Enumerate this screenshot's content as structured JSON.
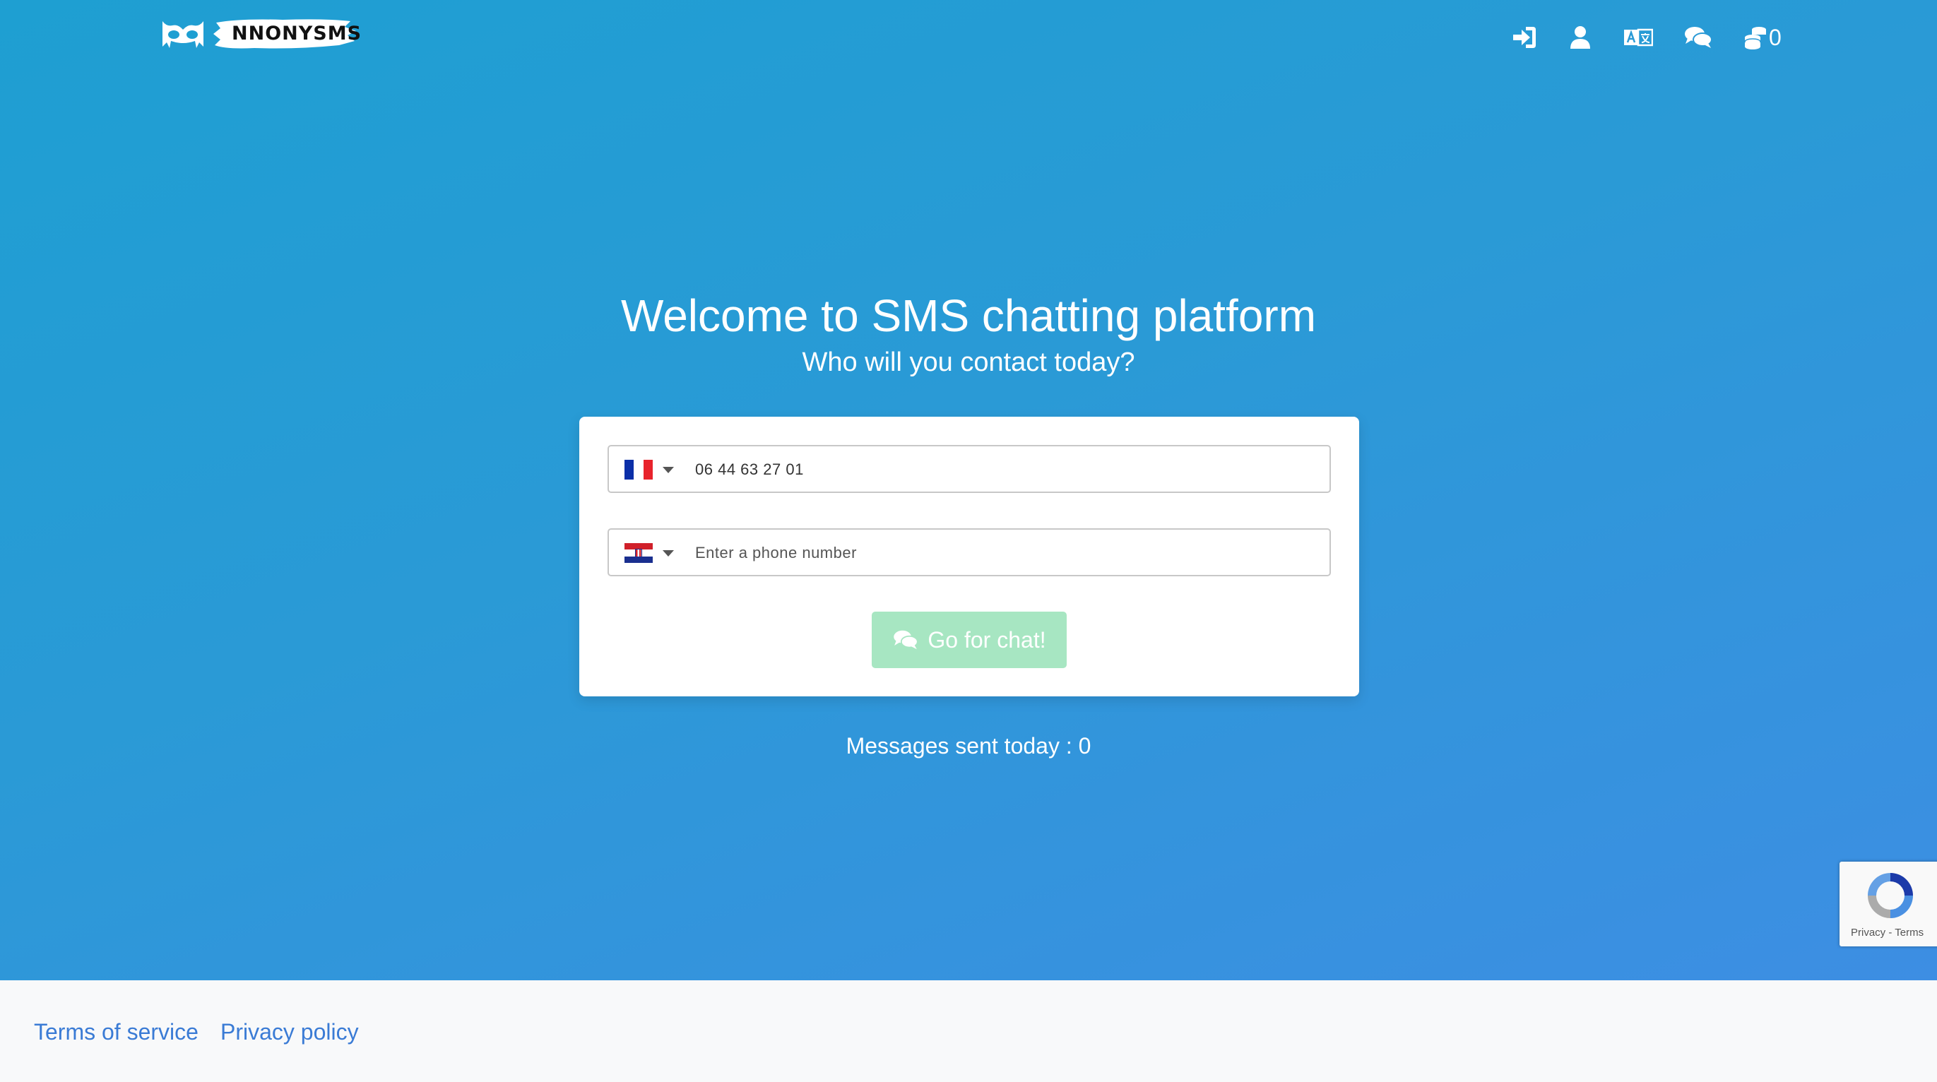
{
  "brand": {
    "name": "ΝNONYSMS"
  },
  "nav": {
    "login_icon": "sign-in-icon",
    "account_icon": "user-icon",
    "language_icon": "translate-icon",
    "chats_icon": "comments-icon",
    "coins_icon": "coins-icon",
    "coin_count": "0"
  },
  "hero": {
    "title": "Welcome to SMS chatting platform",
    "subtitle": "Who will you contact today?"
  },
  "form": {
    "sender": {
      "country_flag": "france-flag-icon",
      "value": "06 44 63 27 01",
      "placeholder": ""
    },
    "recipient": {
      "country_flag": "croatia-flag-icon",
      "value": "",
      "placeholder": "Enter a phone number"
    },
    "submit_label": "Go for chat!",
    "submit_color": "#a7e6c2"
  },
  "stats": {
    "messages_sent": "Messages sent today : 0"
  },
  "recaptcha": {
    "links": "Privacy - Terms"
  },
  "footer": {
    "terms": "Terms of service",
    "privacy": "Privacy policy"
  },
  "colors": {
    "hero_start": "#1e9fd2",
    "hero_end": "#3d8ee3",
    "link": "#3a7bd5"
  }
}
